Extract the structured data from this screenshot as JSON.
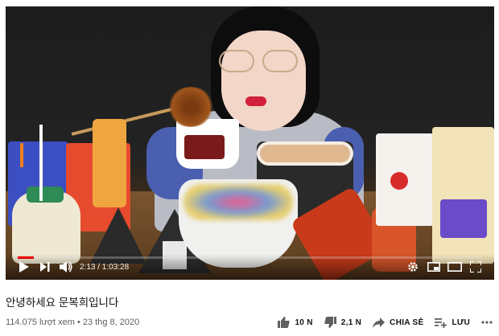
{
  "video": {
    "title": "안녕하세요 문복희입니다",
    "views_date": "114.075 lượt xem • 23 thg 8, 2020",
    "time": "2:13 / 1:03:28",
    "progress_fraction": 0.035
  },
  "actions": {
    "like_count": "10 N",
    "dislike_count": "2,1 N",
    "share_label": "CHIA SẺ",
    "save_label": "LƯU"
  },
  "icons": {
    "play": "play-icon",
    "next": "next-icon",
    "volume": "volume-icon",
    "settings": "gear-icon",
    "miniplayer": "miniplayer-icon",
    "theater": "theater-icon",
    "fullscreen": "fullscreen-icon",
    "like": "thumbs-up-icon",
    "dislike": "thumbs-down-icon",
    "share": "share-icon",
    "save": "playlist-add-icon",
    "more": "more-icon"
  },
  "colors": {
    "progress": "#ff0000",
    "text_primary": "#111111",
    "text_secondary": "#606060"
  }
}
